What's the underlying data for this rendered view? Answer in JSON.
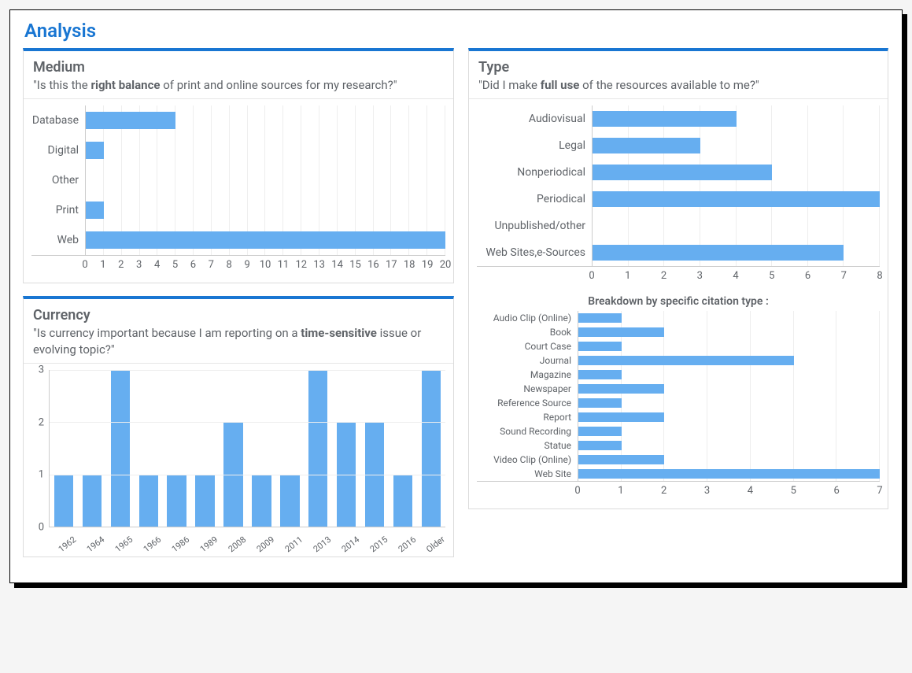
{
  "page_title": "Analysis",
  "panels": {
    "medium": {
      "title": "Medium",
      "subtitle_pre": "\"Is this the ",
      "subtitle_strong": "right balance",
      "subtitle_post": " of print and online sources for my research?\""
    },
    "currency": {
      "title": "Currency",
      "subtitle_pre": "\"Is currency important because I am reporting on a ",
      "subtitle_strong": "time-sensitive",
      "subtitle_post": " issue or evolving topic?\""
    },
    "type": {
      "title": "Type",
      "subtitle_pre": "\"Did I make ",
      "subtitle_strong": "full use",
      "subtitle_post": " of the resources available to me?\"",
      "breakdown_header": "Breakdown by specific citation type :"
    }
  },
  "chart_data": [
    {
      "id": "medium_chart",
      "type": "bar",
      "orientation": "horizontal",
      "categories": [
        "Database",
        "Digital",
        "Other",
        "Print",
        "Web"
      ],
      "values": [
        5,
        1,
        0,
        1,
        20
      ],
      "xlim": [
        0,
        20
      ],
      "xticks": [
        0,
        1,
        2,
        3,
        4,
        5,
        6,
        7,
        8,
        9,
        10,
        11,
        12,
        13,
        14,
        15,
        16,
        17,
        18,
        19,
        20
      ]
    },
    {
      "id": "currency_chart",
      "type": "bar",
      "orientation": "vertical",
      "categories": [
        "1962",
        "1964",
        "1965",
        "1966",
        "1986",
        "1989",
        "2008",
        "2009",
        "2011",
        "2013",
        "2014",
        "2015",
        "2016",
        "Older"
      ],
      "values": [
        1,
        1,
        3,
        1,
        1,
        1,
        2,
        1,
        1,
        3,
        2,
        2,
        1,
        3
      ],
      "ylim": [
        0,
        3
      ],
      "yticks": [
        0,
        1,
        2,
        3
      ]
    },
    {
      "id": "type_chart",
      "type": "bar",
      "orientation": "horizontal",
      "categories": [
        "Audiovisual",
        "Legal",
        "Nonperiodical",
        "Periodical",
        "Unpublished/other",
        "Web Sites,e-Sources"
      ],
      "values": [
        4,
        3,
        5,
        8,
        0,
        7
      ],
      "xlim": [
        0,
        8
      ],
      "xticks": [
        0,
        1,
        2,
        3,
        4,
        5,
        6,
        7,
        8
      ]
    },
    {
      "id": "breakdown_chart",
      "type": "bar",
      "orientation": "horizontal",
      "categories": [
        "Audio Clip (Online)",
        "Book",
        "Court Case",
        "Journal",
        "Magazine",
        "Newspaper",
        "Reference Source",
        "Report",
        "Sound Recording",
        "Statue",
        "Video Clip (Online)",
        "Web Site"
      ],
      "values": [
        1,
        2,
        1,
        5,
        1,
        2,
        1,
        2,
        1,
        1,
        2,
        7
      ],
      "xlim": [
        0,
        7
      ],
      "xticks": [
        0,
        1,
        2,
        3,
        4,
        5,
        6,
        7
      ]
    }
  ]
}
